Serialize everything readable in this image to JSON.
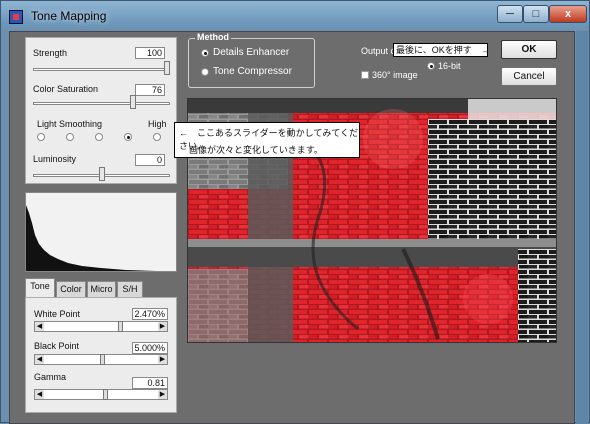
{
  "window": {
    "title": "Tone Mapping",
    "min_glyph": "─",
    "max_glyph": "□",
    "close_glyph": "x"
  },
  "adjust": {
    "strength": {
      "label": "Strength",
      "value": "100"
    },
    "saturation": {
      "label": "Color Saturation",
      "value": "76"
    },
    "smoothing": {
      "label": "Light Smoothing",
      "high_label": "High"
    },
    "luminosity": {
      "label": "Luminosity",
      "value": "0"
    }
  },
  "tabs": [
    "Tone",
    "Color",
    "Micro",
    "S/H"
  ],
  "tone": {
    "white_point": {
      "label": "White Point",
      "value": "2.470%"
    },
    "black_point": {
      "label": "Black Point",
      "value": "5.000%"
    },
    "gamma": {
      "label": "Gamma",
      "value": "0.81"
    }
  },
  "method": {
    "legend": "Method",
    "option1": "Details Enhancer",
    "option2": "Tone Compressor"
  },
  "output": {
    "label_prefix": "Output o",
    "bit_label": "16-bit",
    "image_label": "360° image"
  },
  "buttons": {
    "ok": "OK",
    "cancel": "Cancel"
  },
  "annotations": {
    "ok_hint": "最後に、OKを押す　→",
    "slider_hint_line1": "←　ここあるスライダーを動かしてみてください。",
    "slider_hint_line2": "画像が次々と変化していきます。"
  },
  "colors": {
    "accent_red": "#d8202a",
    "panel": "#ececec",
    "background": "#6d6d6d"
  }
}
